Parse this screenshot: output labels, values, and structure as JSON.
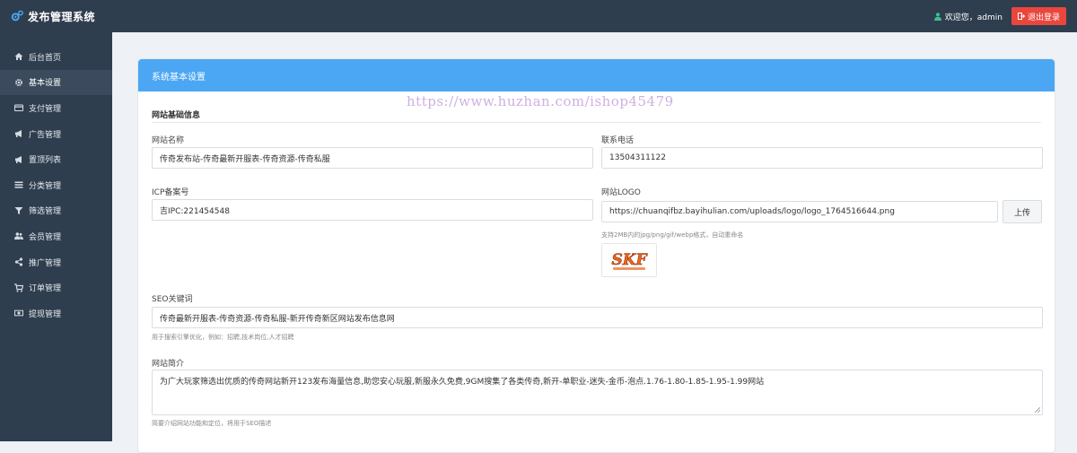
{
  "app": {
    "title": "发布管理系统",
    "welcome": "欢迎您，admin",
    "logout": "退出登录"
  },
  "sidebar": {
    "items": [
      {
        "label": "后台首页",
        "icon": "home-icon"
      },
      {
        "label": "基本设置",
        "icon": "gear-icon",
        "active": true
      },
      {
        "label": "支付管理",
        "icon": "credit-card-icon"
      },
      {
        "label": "广告管理",
        "icon": "bullhorn-icon"
      },
      {
        "label": "置顶列表",
        "icon": "bullhorn-icon"
      },
      {
        "label": "分类管理",
        "icon": "list-icon"
      },
      {
        "label": "筛选管理",
        "icon": "filter-icon"
      },
      {
        "label": "会员管理",
        "icon": "users-icon"
      },
      {
        "label": "推广管理",
        "icon": "share-icon"
      },
      {
        "label": "订单管理",
        "icon": "cart-icon"
      },
      {
        "label": "提现管理",
        "icon": "money-icon"
      }
    ]
  },
  "panel": {
    "title": "系统基本设置",
    "section_title": "网站基础信息"
  },
  "form": {
    "site_name": {
      "label": "网站名称",
      "value": "传奇发布站-传奇最新开服表-传奇资源-传奇私服"
    },
    "phone": {
      "label": "联系电话",
      "value": "13504311122"
    },
    "icp": {
      "label": "ICP备案号",
      "value": "吉IPC:221454548"
    },
    "logo": {
      "label": "网站LOGO",
      "value": "https://chuanqifbz.bayihulian.com/uploads/logo/logo_1764516644.png",
      "upload": "上传",
      "hint": "支持2MB内的jpg/png/gif/webp格式，自动重命名",
      "preview_text": "SKF"
    },
    "seo_keywords": {
      "label": "SEO关键词",
      "value": "传奇最新开服表-传奇资源-传奇私服-新开传奇新区网站发布信息网",
      "hint": "用于搜索引擎优化，例如：招聘,技术岗位,人才招聘"
    },
    "description": {
      "label": "网站简介",
      "value": "为广大玩家筛选出优质的传奇网站新开123发布海量信息,助您安心玩服,新服永久免费,9GM搜集了各类传奇,新开-单职业-迷失-金币-泡点.1.76-1.80-1.85-1.95-1.99网站",
      "hint": "简要介绍网站功能和定位，将用于SEO描述"
    }
  },
  "watermark": "https://www.huzhan.com/ishop45479",
  "colors": {
    "topbar": "#2f3e4e",
    "panel_header": "#4ba7f3",
    "logout": "#e9473e",
    "user_icon": "#3fbf8f"
  }
}
